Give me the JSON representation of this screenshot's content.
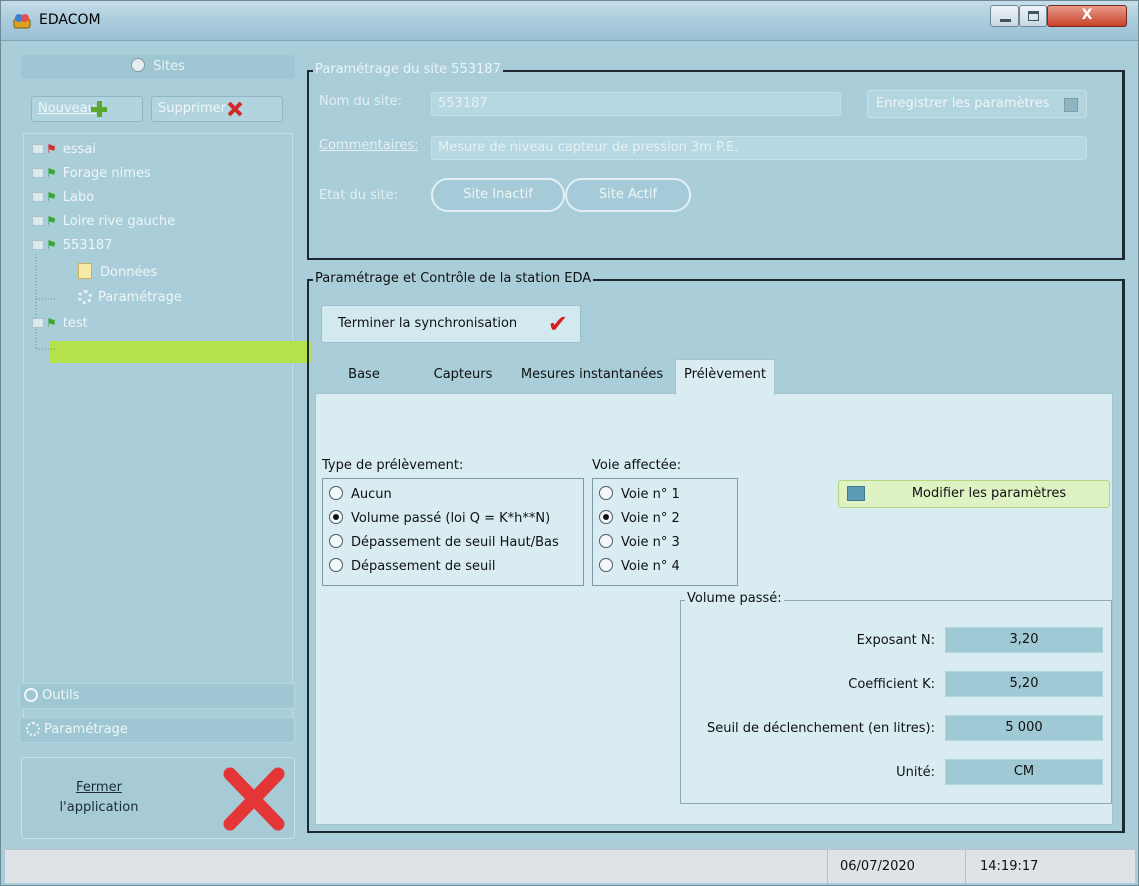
{
  "window": {
    "title": "EDACOM",
    "close_glyph": "X"
  },
  "left": {
    "sites_header": "Sites",
    "new_button": "Nouveau",
    "delete_button": "Supprimer",
    "tree": [
      {
        "label": "essai",
        "flag": "red-flag-icon"
      },
      {
        "label": "Forage nimes",
        "flag": "green-flag-icon"
      },
      {
        "label": "Labo",
        "flag": "green-flag-icon"
      },
      {
        "label": "Loire rive gauche",
        "flag": "green-flag-icon"
      },
      {
        "label": "553187",
        "flag": "green-flag-icon"
      },
      {
        "label": "Données",
        "flag": "document-icon"
      },
      {
        "label": "Paramétrage",
        "flag": "gear-icon"
      },
      {
        "label": "test",
        "flag": "green-flag-icon"
      }
    ],
    "tools_label": "Outils",
    "settings_label": "Paramétrage",
    "close_app_line1": "Fermer",
    "close_app_line2": "l'application"
  },
  "site_params": {
    "title": "Paramétrage du site 553187",
    "name_label": "Nom du site:",
    "name_value": "553187",
    "comment_label": "Commentaires:",
    "comment_value": "Mesure de niveau capteur de pression 3m P.E.",
    "state_label": "Etat du site:",
    "inactive_label": "Site Inactif",
    "active_label": "Site Actif",
    "save_label": "Enregistrer les paramètres"
  },
  "eda": {
    "title": "Paramétrage et Contrôle de la station EDA",
    "sync_label": "Terminer la synchronisation",
    "tabs": [
      "Base",
      "Capteurs",
      "Mesures instantanées",
      "Prélèvement"
    ],
    "active_tab": "Prélèvement",
    "type_label": "Type de prélèvement:",
    "type_options": [
      "Aucun",
      "Volume passé (loi Q = K*h**N)",
      "Dépassement de seuil Haut/Bas",
      "Dépassement de seuil"
    ],
    "type_selected": 1,
    "voie_label": "Voie affectée:",
    "voie_options": [
      "Voie n° 1",
      "Voie n° 2",
      "Voie n° 3",
      "Voie n° 4"
    ],
    "voie_selected": 1,
    "modify_label": "Modifier les paramètres",
    "volume_title": "Volume passé:",
    "params": [
      {
        "label": "Exposant N:",
        "value": "3,20"
      },
      {
        "label": "Coefficient K:",
        "value": "5,20"
      },
      {
        "label": "Seuil de déclenchement (en litres):",
        "value": "5 000"
      },
      {
        "label": "Unité:",
        "value": "CM"
      }
    ]
  },
  "status": {
    "date": "06/07/2020",
    "time": "14:19:17"
  }
}
